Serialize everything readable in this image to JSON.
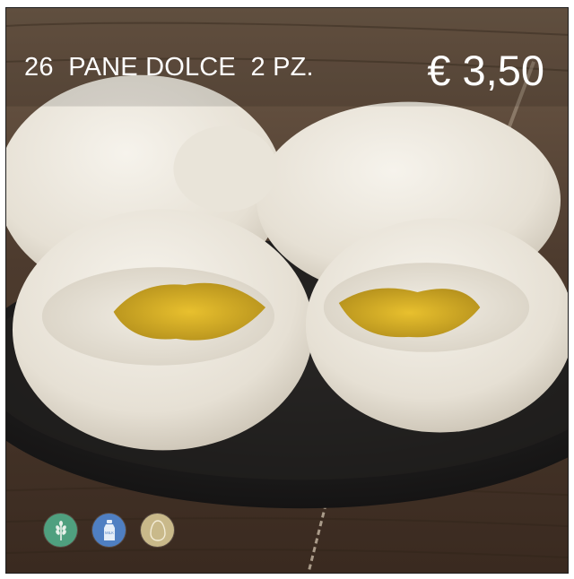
{
  "item": {
    "number": "26",
    "name": "PANE DOLCE",
    "quantity": "2 PZ.",
    "price": "€ 3,50"
  },
  "allergens": [
    {
      "icon": "wheat-icon",
      "color": "#4fa07f"
    },
    {
      "icon": "milk-icon",
      "color": "#4f7fc2",
      "label": "MILK"
    },
    {
      "icon": "egg-icon",
      "color": "#c9b98a"
    }
  ]
}
